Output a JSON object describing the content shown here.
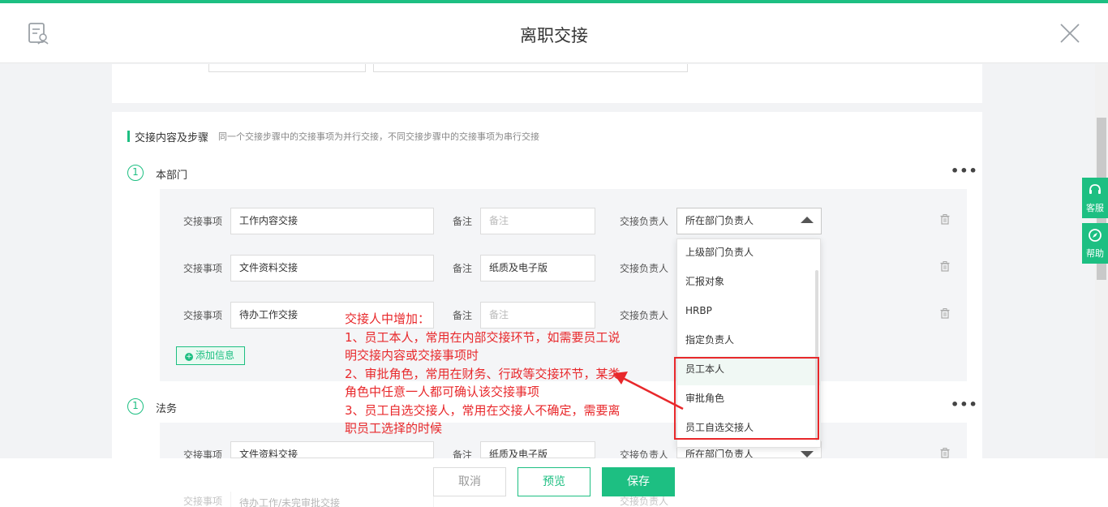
{
  "header": {
    "title": "离职交接"
  },
  "section": {
    "title": "交接内容及步骤",
    "desc": "同一个交接步骤中的交接事项为并行交接，不同交接步骤中的交接事项为串行交接"
  },
  "labels": {
    "item": "交接事项",
    "note": "备注",
    "owner": "交接负责人"
  },
  "step1": {
    "num": "1",
    "name": "本部门",
    "rows": [
      {
        "item": "工作内容交接",
        "note_placeholder": "备注",
        "note": "",
        "owner": "所在部门负责人"
      },
      {
        "item": "文件资料交接",
        "note_placeholder": "",
        "note": "纸质及电子版",
        "owner": ""
      },
      {
        "item": "待办工作交接",
        "note_placeholder": "备注",
        "note": "",
        "owner": ""
      }
    ],
    "add_label": "添加信息"
  },
  "step2": {
    "num": "1",
    "name": "法务",
    "rows": [
      {
        "item": "文件资料交接",
        "note": "纸质及电子版",
        "owner": "所在部门负责人"
      },
      {
        "item": "待办工作/未完审批交接",
        "note": "",
        "owner": ""
      }
    ]
  },
  "dropdown": {
    "options": [
      "上级部门负责人",
      "汇报对象",
      "HRBP",
      "指定负责人",
      "员工本人",
      "审批角色",
      "员工自选交接人"
    ]
  },
  "annotation": {
    "lines": [
      "交接人中增加：",
      "1、员工本人，常用在内部交接环节，如需要员工说明交接内容或交接事项时",
      "2、审批角色，常用在财务、行政等交接环节，某类角色中任意一人都可确认该交接事项",
      "3、员工自选交接人，常用在交接人不确定，需要离职员工选择的时候"
    ]
  },
  "footer": {
    "cancel": "取消",
    "preview": "预览",
    "save": "保存"
  },
  "side": {
    "service": "客服",
    "help": "帮助"
  },
  "colors": {
    "accent": "#1dbf82",
    "annotation": "#e8282b"
  }
}
